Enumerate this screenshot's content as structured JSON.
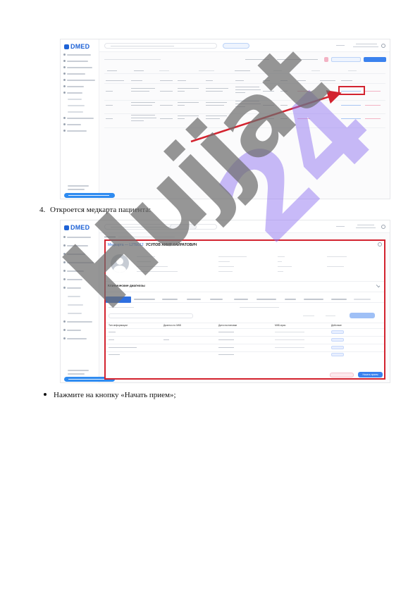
{
  "step": {
    "number": "4.",
    "text": "Откроется медкарта пациента:"
  },
  "bullet": {
    "text": "Нажмите на кнопку «Начать прием»;"
  },
  "screenshot1": {
    "logo": "DMED"
  },
  "screenshot2": {
    "logo": "DMED",
    "title_prefix": "Медкарта — ",
    "patient_id": "L2TE012",
    "patient_name": "УСУПОВ АМИР КАЙРАТОВИЧ",
    "diagnoses_heading": "Клинические диагнозы",
    "table_headers": [
      "Тип информации",
      "Диагноз по МКБ",
      "Дата постановки",
      "МКБ-врач",
      "Действие"
    ],
    "start_button": "Начать прием"
  },
  "watermark": {
    "word1": "Hujjat",
    "word2": "24"
  },
  "colors": {
    "accent": "#2f6fe0",
    "highlight": "#d3232f",
    "watermark_gray": "#6e6e6e",
    "watermark_purple": "#8c6ef0"
  }
}
